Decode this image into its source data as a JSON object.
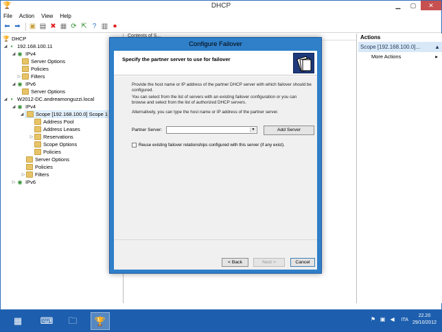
{
  "window": {
    "title": "DHCP"
  },
  "menu": [
    "File",
    "Action",
    "View",
    "Help"
  ],
  "tree": {
    "root": "DHCP",
    "server1": "192.168.100.11",
    "server1_ipv4": "IPv4",
    "server1_server_options": "Server Options",
    "server1_policies": "Policies",
    "server1_filters": "Filters",
    "server1_ipv6": "IPv6",
    "server1_ipv6_server_options": "Server Options",
    "server2": "W2012-DC.andreamonguzzi.local",
    "server2_ipv4": "IPv4",
    "scope": "Scope [192.168.100.0] Scope 1",
    "address_pool": "Address Pool",
    "address_leases": "Address Leases",
    "reservations": "Reservations",
    "scope_options": "Scope Options",
    "scope_policies": "Policies",
    "server2_server_options": "Server Options",
    "server2_policies": "Policies",
    "server2_filters": "Filters",
    "server2_ipv6": "IPv6"
  },
  "center": {
    "header": "Contents of S..."
  },
  "actions": {
    "header": "Actions",
    "scope_item": "Scope [192.168.100.0]...",
    "more_actions": "More Actions"
  },
  "dialog": {
    "title": "Configure Failover",
    "header": "Specify the partner server to use for failover",
    "para1": "Provide the host name or IP address of the partner DHCP server with which failover should be configured.",
    "para2": "You can select from the list of servers with an existing failover configuration or you can browse and select from the list of authorized DHCP servers.",
    "para3": "Alternatively, you can type the host name or IP address of the partner server.",
    "partner_label": "Partner Server:",
    "partner_value": "",
    "add_server": "Add Server",
    "reuse_label": "Reuse existing failover relationships configured with this server (if any exist).",
    "back": "< Back",
    "next": "Next >",
    "cancel": "Cancel"
  },
  "taskbar": {
    "language": "ITA",
    "time": "22.20",
    "date": "29/10/2012"
  }
}
